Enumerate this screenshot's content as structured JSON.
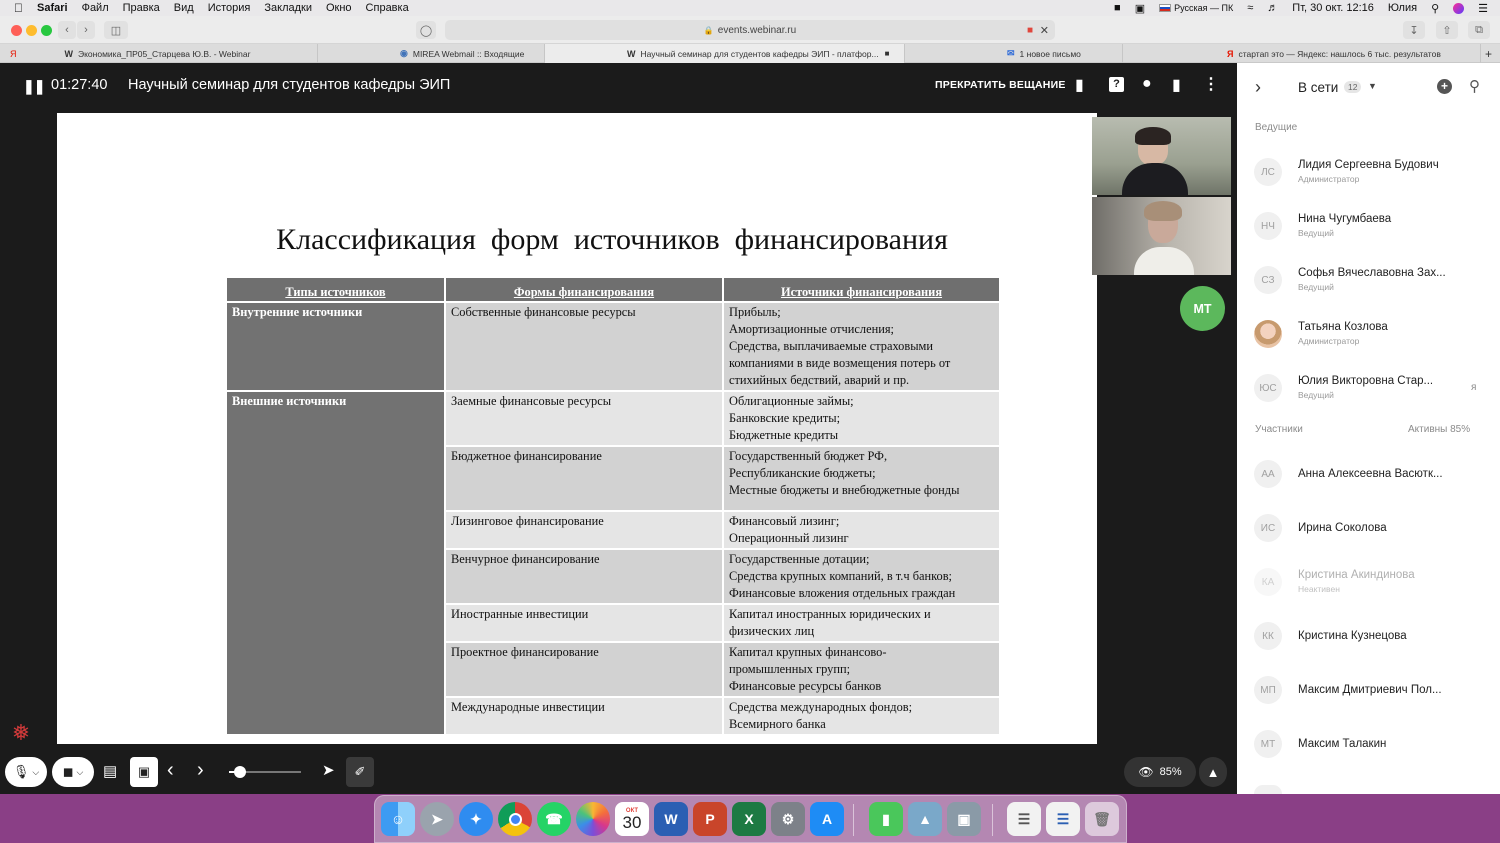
{
  "menubar": {
    "app": "Safari",
    "items": [
      "Файл",
      "Правка",
      "Вид",
      "История",
      "Закладки",
      "Окно",
      "Справка"
    ],
    "keyboard": "Русская — ПК",
    "datetime": "Пт, 30 окт.  12:16",
    "user": "Юлия"
  },
  "toolbar": {
    "url": "events.webinar.ru"
  },
  "tabs": [
    {
      "icon": "W",
      "label": "Экономика_ПР05_Старцева Ю.В. - Webinar"
    },
    {
      "icon": "◉",
      "label": "MIREA Webmail :: Входящие"
    },
    {
      "icon": "W",
      "label": "Научный семинар для студентов кафедры ЭИП - платфор..."
    },
    {
      "icon": "✉",
      "label": "1 новое письмо"
    },
    {
      "icon": "Я",
      "label": "стартап это — Яндекс: нашлось 6 тыс. результатов"
    }
  ],
  "webinar": {
    "timer": "01:27:40",
    "title": "Научный семинар для студентов кафедры ЭИП",
    "stop_label": "ПРЕКРАТИТЬ ВЕЩАНИЕ",
    "self_avatar": "МТ",
    "view_percent": "85%"
  },
  "slide": {
    "title": "Классификация  форм  источников  финансирования",
    "headers": [
      "Типы источников",
      "Формы финансирования",
      "Источники финансирования"
    ],
    "internal_type": "Внутренние источники",
    "external_type": "Внешние источники",
    "rows": [
      {
        "form": "Собственные финансовые ресурсы",
        "sources": [
          "Прибыль;",
          "Амортизационные отчисления;",
          "Средства, выплачиваемые страховыми",
          "компаниями в виде возмещения потерь от",
          "стихийных бедствий, аварий и пр."
        ]
      },
      {
        "form": "Заемные финансовые ресурсы",
        "sources": [
          "Облигационные займы;",
          "Банковские кредиты;",
          "Бюджетные кредиты"
        ]
      },
      {
        "form": "Бюджетное финансирование",
        "sources": [
          "Государственный бюджет РФ,",
          "Республиканские бюджеты;",
          "Местные бюджеты и внебюджетные фонды"
        ]
      },
      {
        "form": "Лизинговое финансирование",
        "sources": [
          "Финансовый лизинг;",
          "Операционный лизинг"
        ]
      },
      {
        "form": "Венчурное финансирование",
        "sources": [
          "Государственные дотации;",
          "Средства крупных компаний, в т.ч банков;",
          "Финансовые вложения отдельных граждан"
        ]
      },
      {
        "form": "Иностранные инвестиции",
        "sources": [
          "Капитал иностранных юридических и",
          "физических лиц"
        ]
      },
      {
        "form": "Проектное финансирование",
        "sources": [
          "Капитал крупных финансово-",
          "промышленных групп;",
          "Финансовые ресурсы банков"
        ]
      },
      {
        "form": "Международные инвестиции",
        "sources": [
          "Средства международных фондов;",
          "Всемирного банка"
        ]
      }
    ]
  },
  "sidebar": {
    "online_label": "В сети",
    "online_count": "12",
    "hosts_label": "Ведущие",
    "participants_label": "Участники",
    "active_label": "Активны 85%",
    "hosts": [
      {
        "initials": "ЛС",
        "name": "Лидия Сергеевна Будович",
        "role": "Администратор"
      },
      {
        "initials": "НЧ",
        "name": "Нина Чугумбаева",
        "role": "Ведущий"
      },
      {
        "initials": "СЗ",
        "name": "Софья Вячеславовна Зах...",
        "role": "Ведущий"
      },
      {
        "initials": "",
        "name": "Татьяна Козлова",
        "role": "Администратор"
      },
      {
        "initials": "ЮС",
        "name": "Юлия Викторовна Стар...",
        "role": "Ведущий",
        "me": "я"
      }
    ],
    "participants": [
      {
        "initials": "АА",
        "name": "Анна Алексеевна Васютк..."
      },
      {
        "initials": "ИС",
        "name": "Ирина Соколова"
      },
      {
        "initials": "КА",
        "name": "Кристина Акиндинова",
        "role": "Неактивен"
      },
      {
        "initials": "КК",
        "name": "Кристина Кузнецова"
      },
      {
        "initials": "МП",
        "name": "Максим Дмитриевич Пол..."
      },
      {
        "initials": "МТ",
        "name": "Максим Талакин"
      }
    ]
  },
  "dock": {
    "calendar_month": "ОКТ",
    "calendar_day": "30"
  }
}
